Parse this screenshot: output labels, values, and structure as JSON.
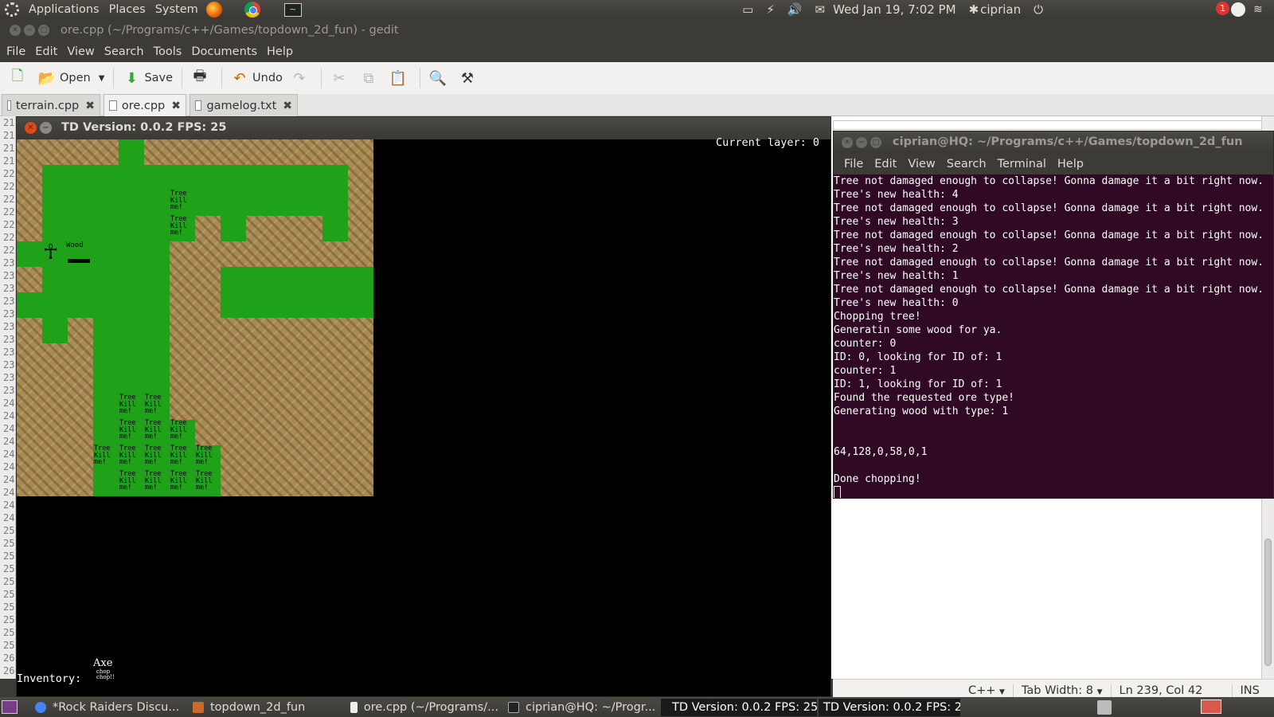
{
  "top_panel": {
    "menus": [
      "Applications",
      "Places",
      "System"
    ],
    "datetime": "Wed Jan 19,  7:02 PM",
    "user": "ciprian",
    "notification_count": "1",
    "icons": [
      "ubuntu-logo-icon",
      "firefox-icon",
      "chrome-icon",
      "system-monitor-icon",
      "display-icon",
      "power-bolt-icon",
      "volume-icon",
      "mail-icon",
      "user-icon",
      "power-icon"
    ]
  },
  "gedit": {
    "title": "ore.cpp (~/Programs/c++/Games/topdown_2d_fun) - gedit",
    "menu": [
      "File",
      "Edit",
      "View",
      "Search",
      "Tools",
      "Documents",
      "Help"
    ],
    "toolbar": {
      "open_label": "Open",
      "save_label": "Save",
      "undo_label": "Undo"
    },
    "tabs": [
      {
        "label": "terrain.cpp"
      },
      {
        "label": "ore.cpp"
      },
      {
        "label": "gamelog.txt"
      }
    ],
    "line_numbers": [
      "21",
      "21",
      "21",
      "21",
      "22",
      "22",
      "22",
      "22",
      "22",
      "22",
      "22",
      "23",
      "23",
      "23",
      "23",
      "23",
      "23",
      "23",
      "23",
      "23",
      "23",
      "23",
      "24",
      "24",
      "24",
      "24",
      "24",
      "24",
      "24",
      "24",
      "24",
      "24",
      "25",
      "25",
      "25",
      "25",
      "25",
      "25",
      "25",
      "25",
      "25",
      "25",
      "26",
      "26"
    ],
    "status": {
      "language": "C++",
      "tab_width": "Tab Width:  8",
      "position": "Ln 239, Col 42",
      "mode": "INS"
    }
  },
  "game": {
    "title": "TD Version: 0.0.2 FPS: 25",
    "current_layer": "Current layer: 0",
    "tree_text": [
      "Tree",
      "Kill",
      "me!"
    ],
    "wood_label": "Wood",
    "inventory_label": "Inventory:",
    "axe_label": "Axe",
    "axe_sub": [
      "chop",
      "chop!!"
    ]
  },
  "terminal": {
    "title": "ciprian@HQ: ~/Programs/c++/Games/topdown_2d_fun",
    "menu": [
      "File",
      "Edit",
      "View",
      "Search",
      "Terminal",
      "Help"
    ],
    "lines": [
      "Tree not damaged enough to collapse! Gonna damage it a bit right now.",
      "Tree's new health: 4",
      "Tree not damaged enough to collapse! Gonna damage it a bit right now.",
      "Tree's new health: 3",
      "Tree not damaged enough to collapse! Gonna damage it a bit right now.",
      "Tree's new health: 2",
      "Tree not damaged enough to collapse! Gonna damage it a bit right now.",
      "Tree's new health: 1",
      "Tree not damaged enough to collapse! Gonna damage it a bit right now.",
      "Tree's new health: 0",
      "Chopping tree!",
      "Generatin some wood for ya.",
      "counter: 0",
      "ID: 0, looking for ID of: 1",
      "counter: 1",
      "ID: 1, looking for ID of: 1",
      "Found the requested ore type!",
      "Generating wood with type: 1",
      "",
      "",
      "64,128,0,58,0,1",
      "",
      "Done chopping!"
    ]
  },
  "taskbar": {
    "tasks": [
      {
        "label": "*Rock Raiders Discu..."
      },
      {
        "label": "topdown_2d_fun"
      },
      {
        "label": "ore.cpp (~/Programs/..."
      },
      {
        "label": "ciprian@HQ: ~/Progr..."
      },
      {
        "label": "TD Version: 0.0.2 FPS: 25"
      }
    ],
    "tooltip": "TD Version: 0.0.2 FPS: 25"
  },
  "colors": {
    "grass": "#1fa21a",
    "dirt": "#a88a52",
    "terminal_bg": "#300a24",
    "panel": "#3c3b37"
  }
}
